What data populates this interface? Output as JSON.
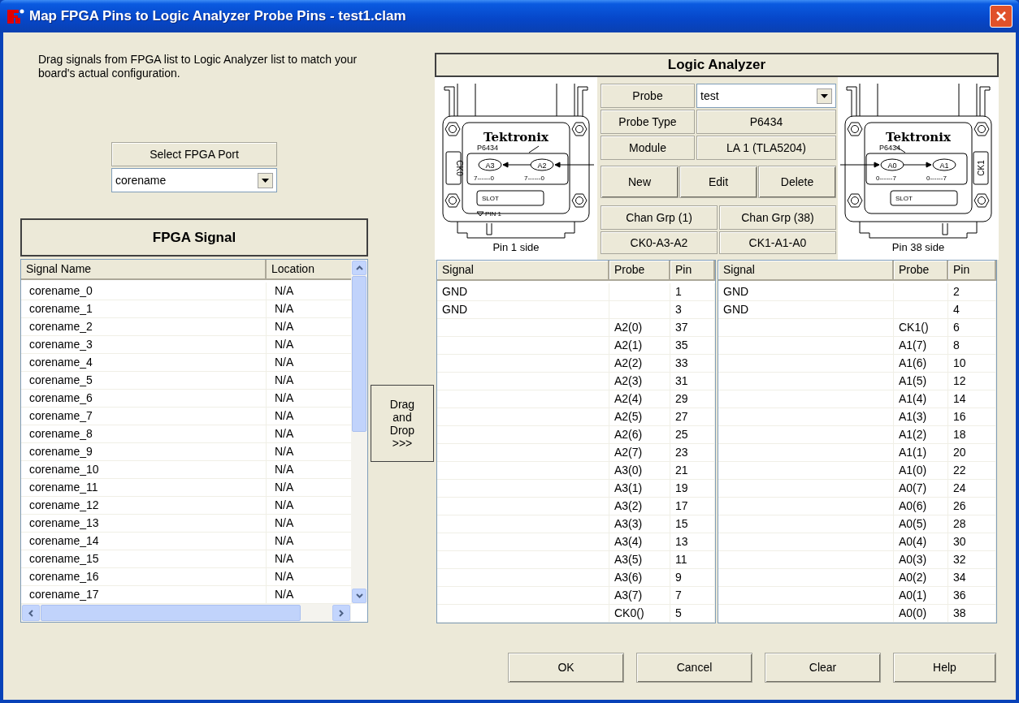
{
  "window": {
    "title": "Map FPGA Pins to Logic Analyzer Probe Pins - test1.clam"
  },
  "instructions": "Drag signals from FPGA list to Logic Analyzer list to match your board's actual configuration.",
  "fpga_port": {
    "label": "Select FPGA Port",
    "value": "corename"
  },
  "fpga_signal": {
    "title": "FPGA Signal",
    "columns": [
      "Signal Name",
      "Location"
    ],
    "rows": [
      {
        "name": "corename_0",
        "location": "N/A"
      },
      {
        "name": "corename_1",
        "location": "N/A"
      },
      {
        "name": "corename_2",
        "location": "N/A"
      },
      {
        "name": "corename_3",
        "location": "N/A"
      },
      {
        "name": "corename_4",
        "location": "N/A"
      },
      {
        "name": "corename_5",
        "location": "N/A"
      },
      {
        "name": "corename_6",
        "location": "N/A"
      },
      {
        "name": "corename_7",
        "location": "N/A"
      },
      {
        "name": "corename_8",
        "location": "N/A"
      },
      {
        "name": "corename_9",
        "location": "N/A"
      },
      {
        "name": "corename_10",
        "location": "N/A"
      },
      {
        "name": "corename_11",
        "location": "N/A"
      },
      {
        "name": "corename_12",
        "location": "N/A"
      },
      {
        "name": "corename_13",
        "location": "N/A"
      },
      {
        "name": "corename_14",
        "location": "N/A"
      },
      {
        "name": "corename_15",
        "location": "N/A"
      },
      {
        "name": "corename_16",
        "location": "N/A"
      },
      {
        "name": "corename_17",
        "location": "N/A"
      }
    ]
  },
  "drag_button": {
    "label": "Drag\nand\nDrop\n>>>"
  },
  "logic_analyzer": {
    "title": "Logic Analyzer",
    "probe": {
      "label": "Probe",
      "value": "test"
    },
    "probe_type": {
      "label": "Probe Type",
      "value": "P6434"
    },
    "module": {
      "label": "Module",
      "value": "LA 1 (TLA5204)"
    },
    "buttons": [
      "New",
      "Edit",
      "Delete"
    ],
    "channel_groups": [
      {
        "label": "Chan Grp (1)",
        "value": "CK0-A3-A2"
      },
      {
        "label": "Chan Grp (38)",
        "value": "CK1-A1-A0"
      }
    ],
    "connectors": [
      {
        "kind": "pin1",
        "brand": "Tektronix",
        "model": "P6434",
        "clock": "CK0",
        "channels": [
          "A3",
          "A2"
        ],
        "scales": [
          "7------0",
          "7------0"
        ],
        "slot": "SLOT",
        "pin_marker": "PIN 1",
        "caption": "Pin 1 side"
      },
      {
        "kind": "pin38",
        "brand": "Tektronix",
        "model": "P6434",
        "clock": "CK1",
        "channels": [
          "A0",
          "A1"
        ],
        "scales": [
          "0------7",
          "0------7"
        ],
        "slot": "SLOT",
        "caption": "Pin 38 side"
      }
    ],
    "pin_tables": [
      {
        "columns": [
          "Signal",
          "Probe",
          "Pin"
        ],
        "rows": [
          {
            "signal": "GND",
            "pin": "1"
          },
          {
            "signal": "GND",
            "pin": "3"
          },
          {
            "probe": "A2(0)",
            "pin": "37"
          },
          {
            "probe": "A2(1)",
            "pin": "35"
          },
          {
            "probe": "A2(2)",
            "pin": "33"
          },
          {
            "probe": "A2(3)",
            "pin": "31"
          },
          {
            "probe": "A2(4)",
            "pin": "29"
          },
          {
            "probe": "A2(5)",
            "pin": "27"
          },
          {
            "probe": "A2(6)",
            "pin": "25"
          },
          {
            "probe": "A2(7)",
            "pin": "23"
          },
          {
            "probe": "A3(0)",
            "pin": "21"
          },
          {
            "probe": "A3(1)",
            "pin": "19"
          },
          {
            "probe": "A3(2)",
            "pin": "17"
          },
          {
            "probe": "A3(3)",
            "pin": "15"
          },
          {
            "probe": "A3(4)",
            "pin": "13"
          },
          {
            "probe": "A3(5)",
            "pin": "11"
          },
          {
            "probe": "A3(6)",
            "pin": "9"
          },
          {
            "probe": "A3(7)",
            "pin": "7"
          },
          {
            "probe": "CK0()",
            "pin": "5"
          }
        ]
      },
      {
        "columns": [
          "Signal",
          "Probe",
          "Pin"
        ],
        "rows": [
          {
            "signal": "GND",
            "pin": "2"
          },
          {
            "signal": "GND",
            "pin": "4"
          },
          {
            "probe": "CK1()",
            "pin": "6"
          },
          {
            "probe": "A1(7)",
            "pin": "8"
          },
          {
            "probe": "A1(6)",
            "pin": "10"
          },
          {
            "probe": "A1(5)",
            "pin": "12"
          },
          {
            "probe": "A1(4)",
            "pin": "14"
          },
          {
            "probe": "A1(3)",
            "pin": "16"
          },
          {
            "probe": "A1(2)",
            "pin": "18"
          },
          {
            "probe": "A1(1)",
            "pin": "20"
          },
          {
            "probe": "A1(0)",
            "pin": "22"
          },
          {
            "probe": "A0(7)",
            "pin": "24"
          },
          {
            "probe": "A0(6)",
            "pin": "26"
          },
          {
            "probe": "A0(5)",
            "pin": "28"
          },
          {
            "probe": "A0(4)",
            "pin": "30"
          },
          {
            "probe": "A0(3)",
            "pin": "32"
          },
          {
            "probe": "A0(2)",
            "pin": "34"
          },
          {
            "probe": "A0(1)",
            "pin": "36"
          },
          {
            "probe": "A0(0)",
            "pin": "38"
          }
        ]
      }
    ]
  },
  "buttons": [
    "OK",
    "Cancel",
    "Clear",
    "Help"
  ]
}
